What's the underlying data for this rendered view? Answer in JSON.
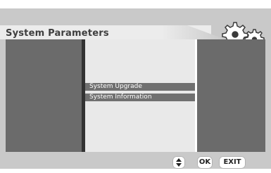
{
  "header": {
    "title": "System Parameters",
    "icon": "gears-icon"
  },
  "menu": {
    "items": [
      {
        "label": "System Upgrade"
      },
      {
        "label": "System Information"
      }
    ]
  },
  "footer": {
    "nav_icon": "up-down-arrows-icon",
    "ok_label": "OK",
    "exit_label": "EXIT"
  },
  "colors": {
    "panel": "#6b6b6b",
    "menu_bg": "#e9e9e9",
    "item_bg": "#707070",
    "frame": "#c9c9c9"
  }
}
